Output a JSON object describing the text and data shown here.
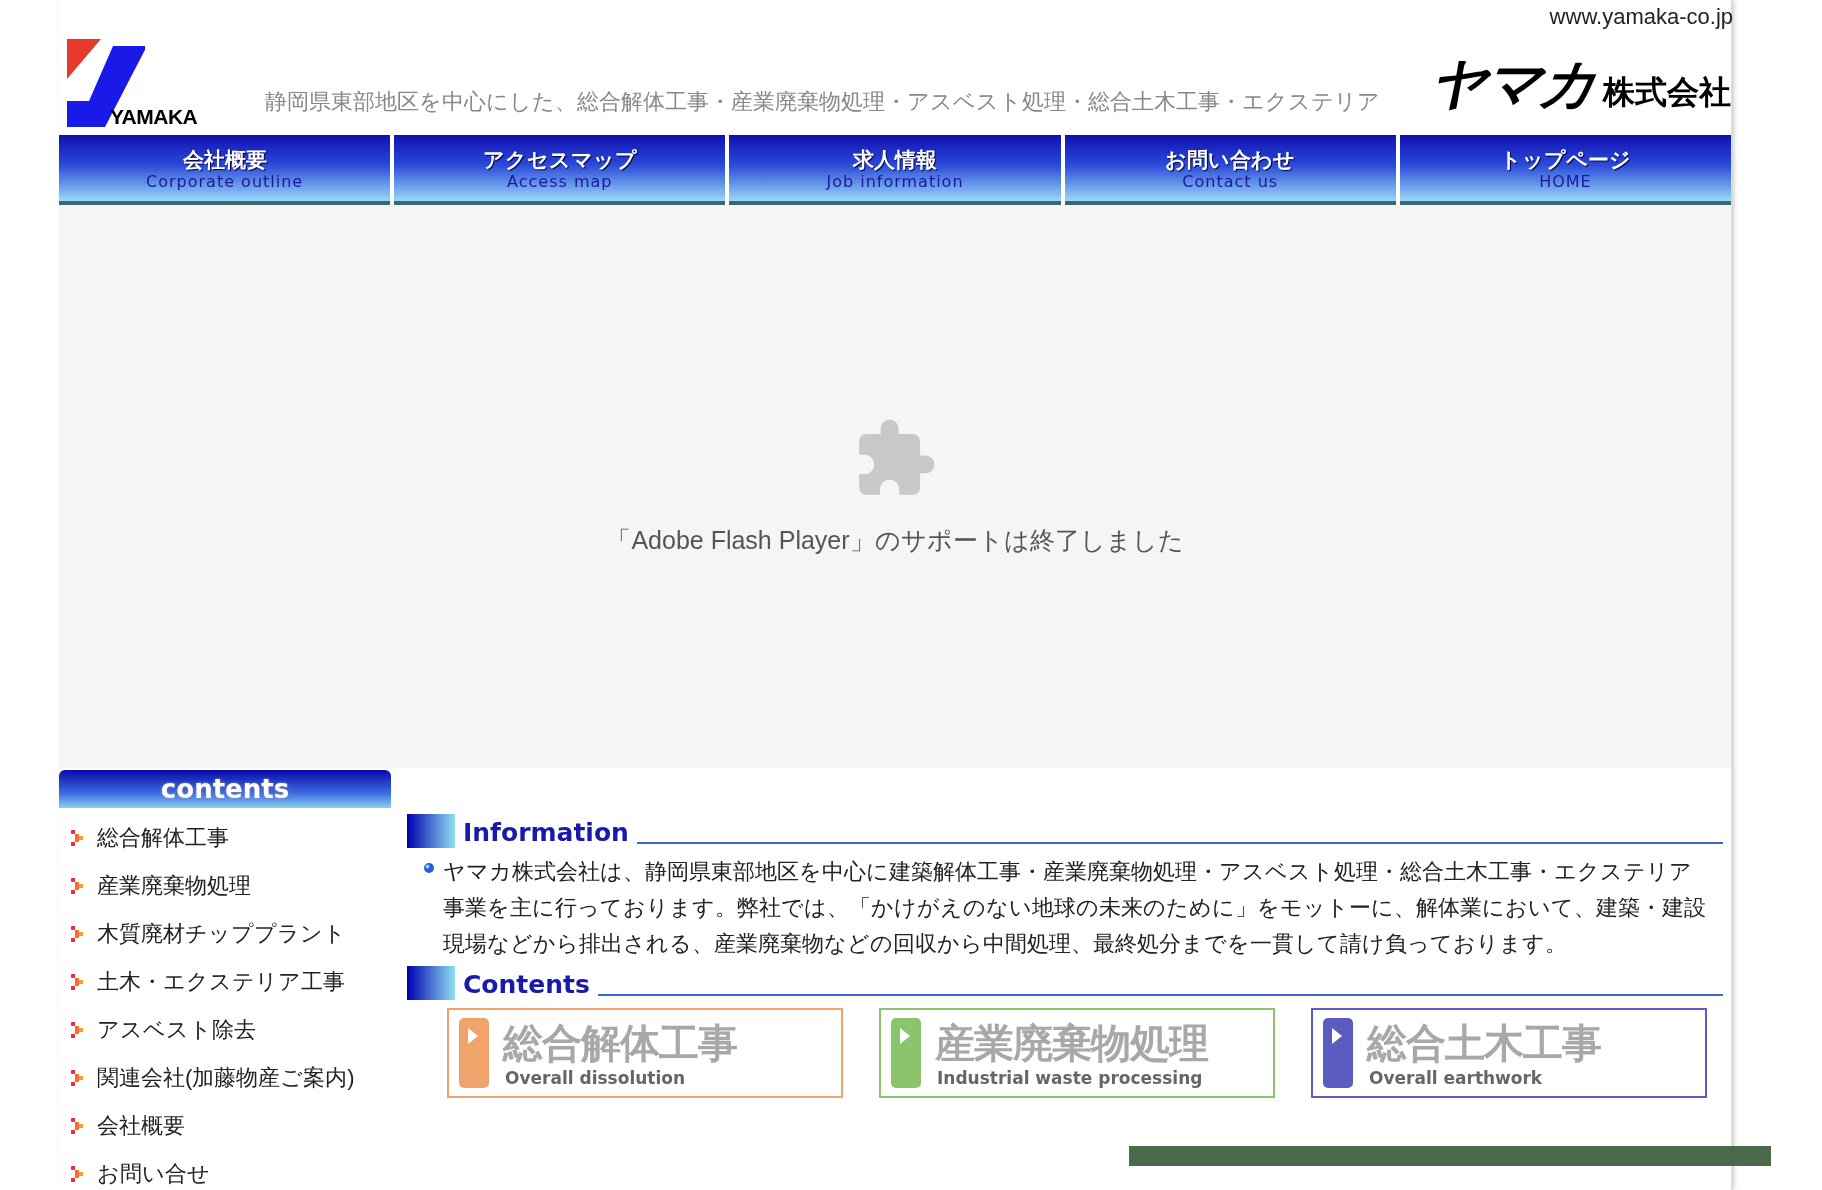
{
  "site_url": "www.yamaka-co.jp",
  "logo_text": "YAMAKA",
  "tagline": "静岡県東部地区を中心にした、総合解体工事・産業廃棄物処理・アスベスト処理・総合土木工事・エクステリア",
  "company_name": "ヤマカ",
  "company_suffix": "株式会社",
  "nav": [
    {
      "label": "会社概要",
      "sublabel": "Corporate outline"
    },
    {
      "label": "アクセスマップ",
      "sublabel": "Access map"
    },
    {
      "label": "求人情報",
      "sublabel": "Job information"
    },
    {
      "label": "お問い合わせ",
      "sublabel": "Contact us"
    },
    {
      "label": "トップページ",
      "sublabel": "HOME"
    }
  ],
  "flash_notice": "「Adobe Flash Player」のサポートは終了しました",
  "sidebar": {
    "title": "contents",
    "items": [
      "総合解体工事",
      "産業廃棄物処理",
      "木質廃材チッププラント",
      "土木・エクステリア工事",
      "アスベスト除去",
      "関連会社(加藤物産ご案内)",
      "会社概要",
      "お問い合せ"
    ]
  },
  "information": {
    "title": "Information",
    "text": "ヤマカ株式会社は、静岡県東部地区を中心に建築解体工事・産業廃棄物処理・アスベスト処理・総合土木工事・エクステリア事業を主に行っております。弊社では、「かけがえのない地球の未来のために」をモットーに、解体業において、建築・建設現場などから排出される、産業廃棄物などの回収から中間処理、最終処分までを一貫して請け負っております。"
  },
  "contents": {
    "title": "Contents",
    "banners": [
      {
        "label": "総合解体工事",
        "sublabel": "Overall dissolution",
        "color": "#f0a46c"
      },
      {
        "label": "産業廃棄物処理",
        "sublabel": "Industrial waste processing",
        "color": "#8cc46c"
      },
      {
        "label": "総合土木工事",
        "sublabel": "Overall earthwork",
        "color": "#5c5cc0"
      }
    ]
  }
}
